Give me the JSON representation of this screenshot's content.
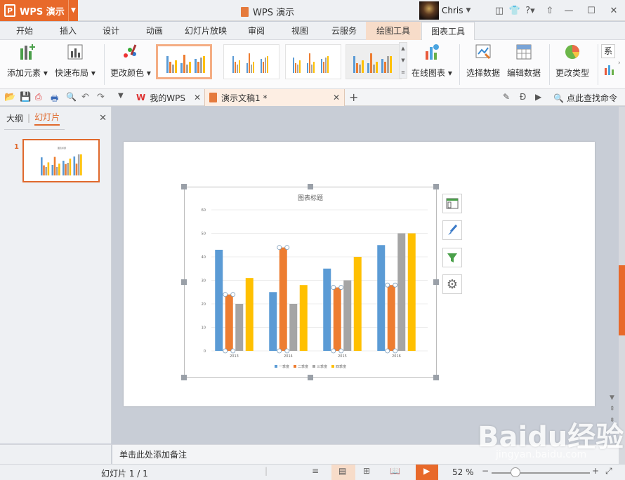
{
  "app": {
    "name": "WPS 演示",
    "doc_title": "WPS 演示",
    "user": "Chris"
  },
  "menu": [
    "开始",
    "插入",
    "设计",
    "动画",
    "幻灯片放映",
    "审阅",
    "视图",
    "云服务",
    "绘图工具",
    "图表工具"
  ],
  "ribbon": {
    "add_element": "添加元素",
    "quick_layout": "快速布局",
    "change_color": "更改颜色",
    "online_chart": "在线图表",
    "select_data": "选择数据",
    "edit_data": "编辑数据",
    "change_type": "更改类型",
    "series_partial": "系"
  },
  "tabs": {
    "mywps": "我的WPS",
    "doc": "演示文稿1 *"
  },
  "search_cmd": "点此查找命令",
  "left_panel": {
    "outline": "大纲",
    "slides": "幻灯片",
    "slide_number": "1"
  },
  "notes_placeholder": "单击此处添加备注",
  "status": {
    "slide_info": "幻灯片 1 / 1",
    "zoom": "52 %",
    "zoom_level": 0.52
  },
  "watermark": {
    "text": "Baidu经验",
    "url": "jingyan.baidu.com"
  },
  "colors": {
    "accent": "#e8692a",
    "series1": "#5b9bd5",
    "series2": "#ed7d31",
    "series3": "#a5a5a5",
    "series4": "#ffc000"
  },
  "chart_data": {
    "type": "bar",
    "title": "图表标题",
    "categories": [
      "2013",
      "2014",
      "2015",
      "2016"
    ],
    "series": [
      {
        "name": "一季度",
        "values": [
          43,
          25,
          35,
          45
        ]
      },
      {
        "name": "二季度",
        "values": [
          24,
          44,
          27,
          28
        ]
      },
      {
        "name": "三季度",
        "values": [
          20,
          20,
          30,
          50
        ]
      },
      {
        "name": "四季度",
        "values": [
          31,
          28,
          40,
          50
        ]
      }
    ],
    "yticks": [
      0,
      10,
      20,
      30,
      40,
      50,
      60
    ],
    "ylim": [
      0,
      60
    ],
    "grid": true,
    "legend": "bottom"
  }
}
